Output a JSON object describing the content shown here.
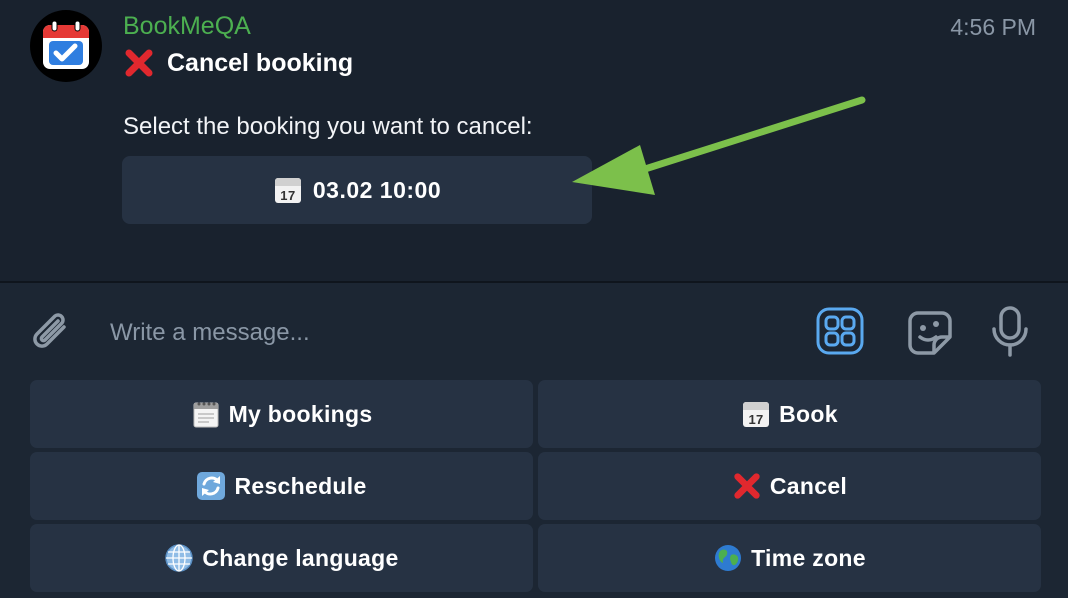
{
  "chat": {
    "sender": "BookMeQA",
    "time": "4:56 PM",
    "title": "Cancel booking",
    "body": "Select the booking you want to cancel:",
    "inline_button": "03.02 10:00"
  },
  "composer": {
    "placeholder": "Write a message..."
  },
  "keyboard": {
    "my_bookings": "My bookings",
    "book": "Book",
    "reschedule": "Reschedule",
    "cancel": "Cancel",
    "change_language": "Change language",
    "time_zone": "Time zone"
  },
  "colors": {
    "background": "#1c2633",
    "button": "#263243",
    "sender": "#4caf50",
    "accent": "#5aa9f0",
    "arrow": "#7cc04b"
  }
}
